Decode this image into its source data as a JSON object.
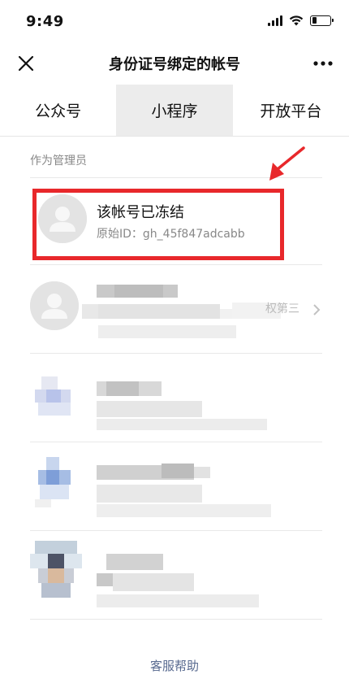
{
  "status": {
    "time": "9:49",
    "battery_level": 0.25
  },
  "nav": {
    "title": "身份证号绑定的帐号",
    "close_icon": "close-icon",
    "more_icon": "more-icon"
  },
  "tabs": [
    {
      "label": "公众号",
      "active": false
    },
    {
      "label": "小程序",
      "active": true
    },
    {
      "label": "开放平台",
      "active": false
    }
  ],
  "section_label": "作为管理员",
  "accounts": [
    {
      "name": "该帐号已冻结",
      "id_prefix": "原始ID：",
      "id": "gh_45f847adcabb",
      "highlighted": true
    },
    {
      "name": "",
      "side_text": "权第三",
      "obscured": true
    },
    {
      "name": "",
      "obscured": true
    },
    {
      "name": "",
      "obscured": true
    },
    {
      "name": "",
      "obscured": true
    }
  ],
  "footer": {
    "link_label": "客服帮助"
  },
  "colors": {
    "highlight": "#e8282b",
    "link": "#57698f",
    "tab_active_bg": "#ececec"
  }
}
